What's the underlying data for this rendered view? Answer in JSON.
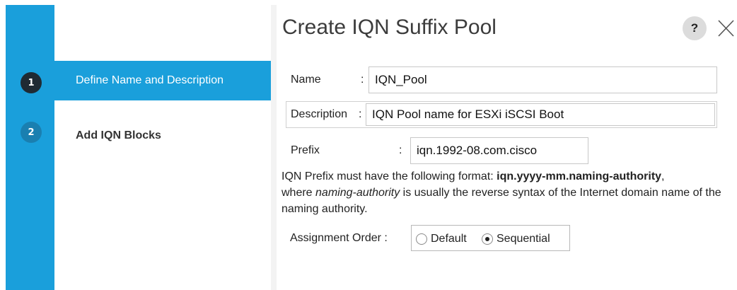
{
  "dialog": {
    "title": "Create IQN Suffix Pool",
    "help_label": "?",
    "close_label": "close"
  },
  "colors": {
    "accent": "#1a9fdb",
    "step_active_circle": "#1f2a33",
    "step_inactive_circle": "#1a7fb0"
  },
  "wizard": {
    "steps": [
      {
        "number": "1",
        "label": "Define Name and Description",
        "active": true
      },
      {
        "number": "2",
        "label": "Add IQN Blocks",
        "active": false
      }
    ]
  },
  "form": {
    "name": {
      "label": "Name",
      "colon": ":",
      "value": "IQN_Pool"
    },
    "description": {
      "label": "Description",
      "colon": ":",
      "value": "IQN Pool name for ESXi iSCSI Boot"
    },
    "prefix": {
      "label": "Prefix",
      "colon": ":",
      "value": "iqn.1992-08.com.cisco"
    },
    "help": {
      "line1_prefix": "IQN Prefix must have the following format: ",
      "format": "iqn.yyyy-mm.naming-authority",
      "line1_suffix": ",",
      "where": "where ",
      "naming_authority": "naming-authority",
      "rest": " is usually the reverse syntax of the Internet domain name of the naming authority."
    },
    "assignment_order": {
      "label": "Assignment Order :",
      "options": [
        {
          "label": "Default",
          "selected": false
        },
        {
          "label": "Sequential",
          "selected": true
        }
      ]
    }
  }
}
